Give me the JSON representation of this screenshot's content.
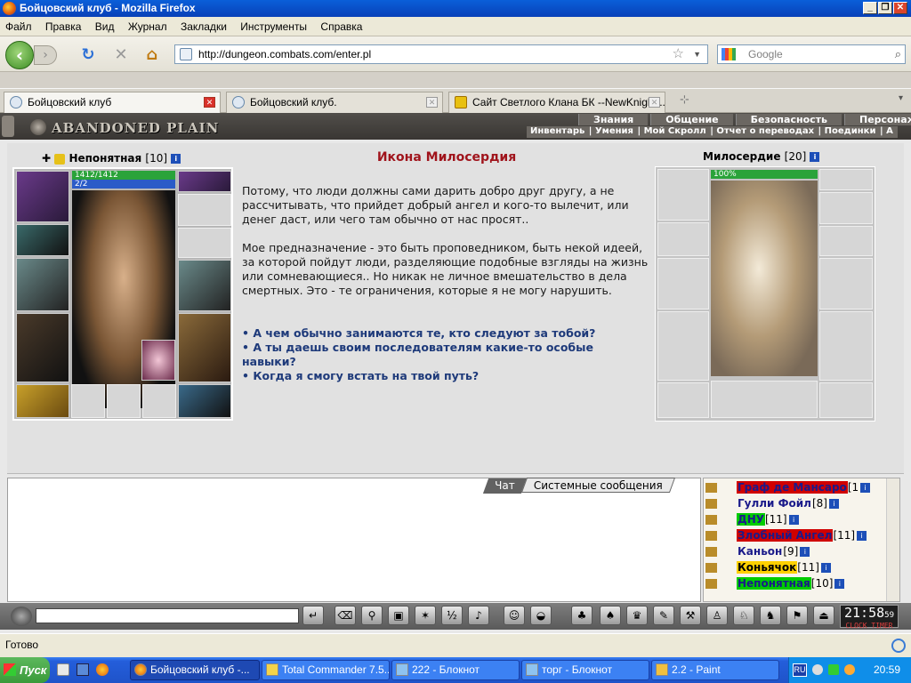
{
  "window": {
    "title": "Бойцовский клуб - Mozilla Firefox"
  },
  "menu": [
    "Файл",
    "Правка",
    "Вид",
    "Журнал",
    "Закладки",
    "Инструменты",
    "Справка"
  ],
  "nav": {
    "url": "http://dungeon.combats.com/enter.pl",
    "search_placeholder": "Google"
  },
  "tabs": [
    {
      "label": "Бойцовский клуб"
    },
    {
      "label": "Бойцовский клуб."
    },
    {
      "label": "Сайт Светлого Клана БК --NewKnight..."
    }
  ],
  "game": {
    "logo": "ABANDONED PLAIN",
    "top_menu": [
      "Знания",
      "Общение",
      "Безопасность",
      "Персонаж"
    ],
    "sub_menu": [
      "Инвентарь",
      "Умения",
      "Мой Скролл",
      "Отчет о переводах",
      "Поединки",
      "А"
    ],
    "player": {
      "name": "Непонятная",
      "level": "[10]",
      "hp": "1412/1412",
      "mp": "2/2"
    },
    "npc": {
      "name": "Милосердие",
      "level": "[20]",
      "hp": "100%"
    },
    "dialog": {
      "title": "Икона Милосердия",
      "paragraphs": [
        "Потому, что люди должны сами дарить добро друг другу, а не рассчитывать, что прийдет добрый ангел и кого-то вылечит, или денег даст, или чего там обычно от нас просят..",
        "Мое предназначение - это быть проповедником, быть некой идеей, за которой пойдут люди, разделяющие подобные взгляды на жизнь или сомневающиеся.. Но никак не личное вмешательство в дела смертных. Это - те ограничения, которые я не могу нарушить."
      ],
      "options": [
        "• А чем обычно занимаются те, кто следуют за тобой?",
        "• А ты даешь своим последователям какие-то особые навыки?",
        "• Когда я смогу встать на твой путь?"
      ]
    },
    "chat_tabs": [
      "Чат",
      "Системные сообщения"
    ],
    "users": [
      {
        "name": "Граф де Мансаро",
        "level": "[1",
        "bg": "#d00000",
        "fg": "#1a1a8a"
      },
      {
        "name": "Гулли Фойл",
        "level": "[8]",
        "bg": "",
        "fg": "#1a1a8a"
      },
      {
        "name": "ДНУ",
        "level": "[11]",
        "bg": "#00cc00",
        "fg": "#1a1a8a"
      },
      {
        "name": "Злобный Ангел",
        "level": "[11]",
        "bg": "#d00000",
        "fg": "#1a1a8a"
      },
      {
        "name": "Каньон",
        "level": "[9]",
        "bg": "",
        "fg": "#1a1a8a"
      },
      {
        "name": "Коньячок",
        "level": "[11]",
        "bg": "#ffd000",
        "fg": "#000000"
      },
      {
        "name": "Непонятная",
        "level": "[10]",
        "bg": "#00cc00",
        "fg": "#1a1a8a"
      }
    ],
    "clock": {
      "time": "21:58",
      "sec": "59",
      "labels": "CLOCK TIMER"
    }
  },
  "status": "Готово",
  "taskbar": {
    "start": "Пуск",
    "tasks": [
      "Бойцовский клуб -...",
      "Total Commander 7.5...",
      "222 - Блокнот",
      "торг - Блокнот",
      "2.2 - Paint"
    ],
    "lang": "RU",
    "time": "20:59"
  }
}
